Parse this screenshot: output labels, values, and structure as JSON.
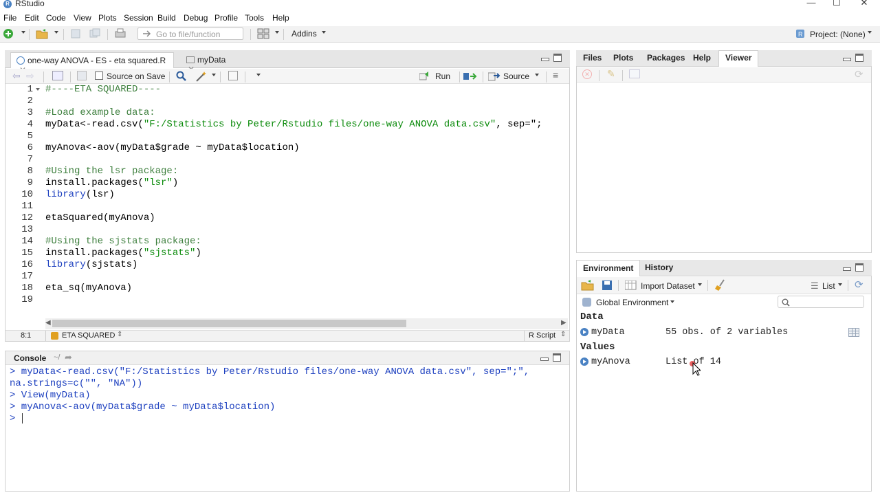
{
  "window": {
    "title": "RStudio"
  },
  "menu": [
    "File",
    "Edit",
    "Code",
    "View",
    "Plots",
    "Session",
    "Build",
    "Debug",
    "Profile",
    "Tools",
    "Help"
  ],
  "toolbar": {
    "goto_placeholder": "Go to file/function",
    "addins_label": "Addins",
    "project_label": "Project: (None)"
  },
  "editor": {
    "tabs": [
      {
        "label": "one-way ANOVA - ES - eta squared.R"
      },
      {
        "label": "myData"
      }
    ],
    "source_on_save_label": "Source on Save",
    "run_label": "Run",
    "source_label": "Source",
    "lines": [
      {
        "n": "1",
        "segs": [
          {
            "t": "#----ETA SQUARED----",
            "c": "cmt"
          }
        ]
      },
      {
        "n": "2",
        "segs": []
      },
      {
        "n": "3",
        "segs": [
          {
            "t": "#Load example data:",
            "c": "cmt"
          }
        ]
      },
      {
        "n": "4",
        "segs": [
          {
            "t": "myData<-read.csv(",
            "c": ""
          },
          {
            "t": "\"F:/Statistics by Peter/Rstudio files/one-way ANOVA data.csv\"",
            "c": "str"
          },
          {
            "t": ", sep=\";",
            "c": ""
          }
        ]
      },
      {
        "n": "5",
        "segs": []
      },
      {
        "n": "6",
        "segs": [
          {
            "t": "myAnova<-aov(myData$grade ~ myData$location)",
            "c": ""
          }
        ]
      },
      {
        "n": "7",
        "segs": []
      },
      {
        "n": "8",
        "segs": [
          {
            "t": "#Using the lsr package:",
            "c": "cmt"
          }
        ]
      },
      {
        "n": "9",
        "segs": [
          {
            "t": "install.packages(",
            "c": ""
          },
          {
            "t": "\"lsr\"",
            "c": "str"
          },
          {
            "t": ")",
            "c": ""
          }
        ]
      },
      {
        "n": "10",
        "segs": [
          {
            "t": "library",
            "c": "kw"
          },
          {
            "t": "(lsr)",
            "c": ""
          }
        ]
      },
      {
        "n": "11",
        "segs": []
      },
      {
        "n": "12",
        "segs": [
          {
            "t": "etaSquared(myAnova)",
            "c": ""
          }
        ]
      },
      {
        "n": "13",
        "segs": []
      },
      {
        "n": "14",
        "segs": [
          {
            "t": "#Using the sjstats package:",
            "c": "cmt"
          }
        ]
      },
      {
        "n": "15",
        "segs": [
          {
            "t": "install.packages(",
            "c": ""
          },
          {
            "t": "\"sjstats\"",
            "c": "str"
          },
          {
            "t": ")",
            "c": ""
          }
        ]
      },
      {
        "n": "16",
        "segs": [
          {
            "t": "library",
            "c": "kw"
          },
          {
            "t": "(sjstats)",
            "c": ""
          }
        ]
      },
      {
        "n": "17",
        "segs": []
      },
      {
        "n": "18",
        "segs": [
          {
            "t": "eta_sq(myAnova)",
            "c": ""
          }
        ]
      },
      {
        "n": "19",
        "segs": []
      }
    ],
    "status": {
      "position": "8:1",
      "section": "ETA SQUARED",
      "filetype": "R Script"
    }
  },
  "console": {
    "title": "Console",
    "path": "~/",
    "lines": [
      "> myData<-read.csv(\"F:/Statistics by Peter/Rstudio files/one-way ANOVA data.csv\", sep=\";\",",
      "na.strings=c(\"\", \"NA\"))",
      "> View(myData)",
      "> myAnova<-aov(myData$grade ~ myData$location)",
      "> "
    ]
  },
  "viewer": {
    "tabs": [
      "Files",
      "Plots",
      "Packages",
      "Help",
      "Viewer"
    ]
  },
  "environment": {
    "tabs": [
      "Environment",
      "History"
    ],
    "import_label": "Import Dataset",
    "list_label": "List",
    "scope_label": "Global Environment",
    "sections": {
      "data_title": "Data",
      "values_title": "Values"
    },
    "data_rows": [
      {
        "name": "myData",
        "value": "55 obs. of 2 variables"
      }
    ],
    "value_rows": [
      {
        "name": "myAnova",
        "value": "List of 14"
      }
    ]
  },
  "colors": {
    "comment": "#3d7f3d",
    "string": "#0a8a0a",
    "keyword": "#1c3fbf",
    "accent": "#4a82c3"
  }
}
